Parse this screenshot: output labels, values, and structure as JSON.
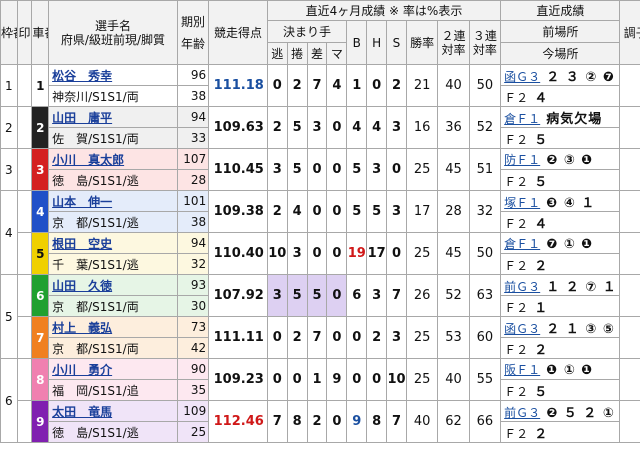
{
  "header": {
    "waku": "枠番",
    "shirushi": "印",
    "sha": "車番",
    "name1": "選手名",
    "name2": "府県/級班前現/脚質",
    "kibetsu": "期別",
    "nenrei": "年齢",
    "score": "競走得点",
    "recent": "直近4ヶ月成績 ※ 率は%表示",
    "kimarite": "決まり手",
    "nige": "逃",
    "makuri": "捲",
    "sashi": "差",
    "mark": "マ",
    "b": "B",
    "h": "H",
    "s": "S",
    "win": "勝率",
    "rate2a": "２連",
    "rate2b": "対率",
    "rate3a": "３連",
    "rate3b": "対率",
    "latest": "直近成績",
    "zen": "前場所",
    "ima": "今場所",
    "cond": "調子"
  },
  "colors": {
    "car1": "#ffffff",
    "car2": "#222222",
    "car3": "#d42020",
    "car4": "#2050c8",
    "car5": "#f0d000",
    "car6": "#20a030",
    "car7": "#f08020",
    "car8": "#f080b0",
    "car9": "#8020b0"
  },
  "riders": [
    {
      "waku": "1",
      "car": "1",
      "name": "松谷　秀幸",
      "pref": "神奈川/S1S1/両",
      "ki": "96",
      "age": "38",
      "score": "111.18",
      "scoreColor": "blue",
      "n": "0",
      "m": "2",
      "sa": "7",
      "ma": "4",
      "b": "1",
      "h": "0",
      "s": "2",
      "w": "21",
      "r2": "40",
      "r3": "50",
      "prevGrade": "函Ｇ３",
      "prevRes": "２ ３ ② ❼",
      "curGrade": "Ｆ２",
      "curRes": "４",
      "bg": "#ffffff",
      "textColor": "#111"
    },
    {
      "waku": "2",
      "car": "2",
      "name": "山田　庸平",
      "pref": "佐　賀/S1S1/両",
      "ki": "94",
      "age": "33",
      "score": "109.63",
      "scoreColor": "",
      "n": "2",
      "m": "5",
      "sa": "3",
      "ma": "0",
      "b": "4",
      "h": "4",
      "s": "3",
      "w": "16",
      "r2": "36",
      "r3": "52",
      "prevGrade": "倉Ｆ１",
      "prevRes": "病気欠場",
      "curGrade": "Ｆ２",
      "curRes": "５",
      "bg": "#f0f0f0",
      "textColor": "#fff"
    },
    {
      "waku": "3",
      "car": "3",
      "name": "小川　真太郎",
      "pref": "徳　島/S1S1/逃",
      "ki": "107",
      "age": "28",
      "score": "110.45",
      "scoreColor": "",
      "n": "3",
      "m": "5",
      "sa": "0",
      "ma": "0",
      "b": "5",
      "h": "3",
      "s": "0",
      "w": "25",
      "r2": "45",
      "r3": "51",
      "prevGrade": "防Ｆ１",
      "prevRes": "❷ ③ ❶",
      "curGrade": "Ｆ２",
      "curRes": "５",
      "bg": "#fde4e4",
      "textColor": "#fff"
    },
    {
      "waku": "4",
      "car": "4",
      "name": "山本　伸一",
      "pref": "京　都/S1S1/逃",
      "ki": "101",
      "age": "38",
      "score": "109.38",
      "scoreColor": "",
      "n": "2",
      "m": "4",
      "sa": "0",
      "ma": "0",
      "b": "5",
      "h": "5",
      "s": "3",
      "w": "17",
      "r2": "28",
      "r3": "32",
      "prevGrade": "塚Ｆ１",
      "prevRes": "❸ ④ １",
      "curGrade": "Ｆ２",
      "curRes": "４",
      "bg": "#e4ecfa",
      "textColor": "#fff"
    },
    {
      "waku": "4",
      "car": "5",
      "name": "根田　空史",
      "pref": "千　葉/S1S1/逃",
      "ki": "94",
      "age": "32",
      "score": "110.40",
      "scoreColor": "",
      "n": "10",
      "m": "3",
      "sa": "0",
      "ma": "0",
      "b": "19",
      "h": "17",
      "s": "0",
      "w": "25",
      "r2": "45",
      "r3": "50",
      "prevGrade": "倉Ｆ１",
      "prevRes": "❼ ① ❶",
      "curGrade": "Ｆ２",
      "curRes": "２",
      "bg": "#fdf8e0",
      "textColor": "#111"
    },
    {
      "waku": "5",
      "car": "6",
      "name": "山田　久徳",
      "pref": "京　都/S1S1/両",
      "ki": "93",
      "age": "30",
      "score": "107.92",
      "scoreColor": "",
      "n": "3",
      "m": "5",
      "sa": "5",
      "ma": "0",
      "b": "6",
      "h": "3",
      "s": "7",
      "w": "26",
      "r2": "52",
      "r3": "63",
      "prevGrade": "前Ｇ３",
      "prevRes": "１ ２ ⑦ １",
      "curGrade": "Ｆ２",
      "curRes": "１",
      "bg": "#e6f5e6",
      "textColor": "#fff"
    },
    {
      "waku": "5",
      "car": "7",
      "name": "村上　義弘",
      "pref": "京　都/S1S1/両",
      "ki": "73",
      "age": "42",
      "score": "111.11",
      "scoreColor": "",
      "n": "0",
      "m": "2",
      "sa": "7",
      "ma": "0",
      "b": "0",
      "h": "2",
      "s": "3",
      "w": "25",
      "r2": "53",
      "r3": "60",
      "prevGrade": "函Ｇ３",
      "prevRes": "２ １ ③ ⑤",
      "curGrade": "Ｆ２",
      "curRes": "２",
      "bg": "#fdeedd",
      "textColor": "#fff"
    },
    {
      "waku": "6",
      "car": "8",
      "name": "小川　勇介",
      "pref": "福　岡/S1S1/追",
      "ki": "90",
      "age": "35",
      "score": "109.23",
      "scoreColor": "",
      "n": "0",
      "m": "0",
      "sa": "1",
      "ma": "9",
      "b": "0",
      "h": "0",
      "s": "10",
      "w": "25",
      "r2": "40",
      "r3": "55",
      "prevGrade": "阪Ｆ１",
      "prevRes": "❶ ① ❶",
      "curGrade": "Ｆ２",
      "curRes": "５",
      "bg": "#fde8f0",
      "textColor": "#fff"
    },
    {
      "waku": "6",
      "car": "9",
      "name": "太田　竜馬",
      "pref": "徳　島/S1S1/逃",
      "ki": "109",
      "age": "25",
      "score": "112.46",
      "scoreColor": "red",
      "n": "7",
      "m": "8",
      "sa": "2",
      "ma": "0",
      "b": "9",
      "h": "8",
      "s": "7",
      "w": "40",
      "r2": "62",
      "r3": "66",
      "prevGrade": "前Ｇ３",
      "prevRes": "❷ ５ ２ ①",
      "curGrade": "Ｆ２",
      "curRes": "２",
      "bg": "#f0e4f8",
      "textColor": "#fff"
    }
  ]
}
